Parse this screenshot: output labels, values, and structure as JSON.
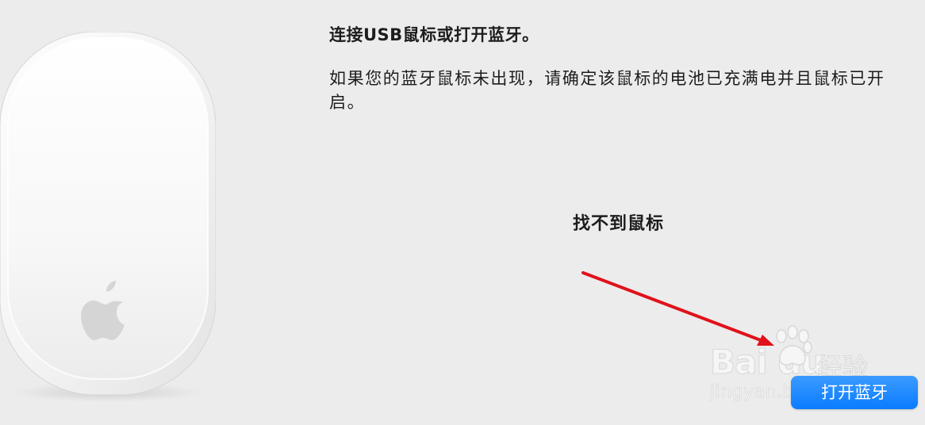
{
  "dialog": {
    "title": "连接USB鼠标或打开蓝牙。",
    "description": "如果您的蓝牙鼠标未出现，请确定该鼠标的电池已充满电并且鼠标已开启。",
    "bluetooth_button_label": "打开蓝牙"
  },
  "annotation": {
    "text": "找不到鼠标",
    "arrow_color": "#e0121b"
  },
  "illustration": {
    "icon": "magic-mouse-with-apple-logo"
  },
  "watermark": {
    "brand": "Bai du",
    "product": "经验",
    "url": "jingyan.baidu.com"
  },
  "colors": {
    "background": "#ececec",
    "button": "#0a7cff",
    "button_text": "#ffffff",
    "text": "#1d1d1f"
  }
}
